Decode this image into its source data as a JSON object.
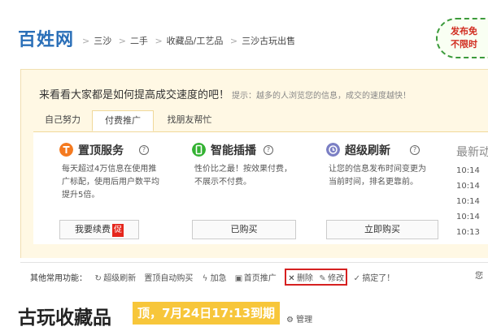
{
  "header": {
    "logo_text": "百姓网",
    "breadcrumbs": [
      "三沙",
      "二手",
      "收藏品/工艺品",
      "三沙古玩出售"
    ],
    "badge_line1": "发布免",
    "badge_line2": "不限时"
  },
  "promo": {
    "headline": "来看看大家都是如何提高成交速度的吧！",
    "hint": "提示：越多的人浏览您的信息，成交的速度越快！",
    "tabs": [
      {
        "label": "自己努力",
        "active": false
      },
      {
        "label": "付费推广",
        "active": true
      },
      {
        "label": "找朋友帮忙",
        "active": false
      }
    ],
    "services": [
      {
        "name": "置顶服务",
        "desc": "每天超过4万信息在使用推广标配，使用后用户数平均提升5倍。",
        "button": "我要续费",
        "button_tag": "促",
        "icon": "top-icon",
        "color": "#f47a20"
      },
      {
        "name": "智能插播",
        "desc": "性价比之最！按效果付费，不展示不付费。",
        "button": "已购买",
        "icon": "phone-icon",
        "color": "#34b233"
      },
      {
        "name": "超级刷新",
        "desc": "让您的信息发布时间变更为当前时间，排名更靠前。",
        "button": "立即购买",
        "icon": "clock-icon",
        "color": "#7b7fc4"
      }
    ],
    "latest_title": "最新动",
    "latest_times": [
      "10:14",
      "10:14",
      "10:14",
      "10:14",
      "10:13"
    ]
  },
  "functions": {
    "label": "其他常用功能：",
    "items": [
      {
        "label": "超级刷新",
        "icon": "refresh-icon"
      },
      {
        "label": "置顶自动购买",
        "icon": ""
      },
      {
        "label": "加急",
        "icon": "lightning-icon"
      },
      {
        "label": "首页推广",
        "icon": "image-icon"
      },
      {
        "label": "删除",
        "icon": "delete-icon"
      },
      {
        "label": "修改",
        "icon": "edit-icon"
      },
      {
        "label": "搞定了！",
        "icon": "check-icon"
      }
    ],
    "right_text": "您"
  },
  "post": {
    "title": "古玩收藏品",
    "top_badge": "顶，7月24日17:13到期",
    "manage_label": "管理"
  }
}
